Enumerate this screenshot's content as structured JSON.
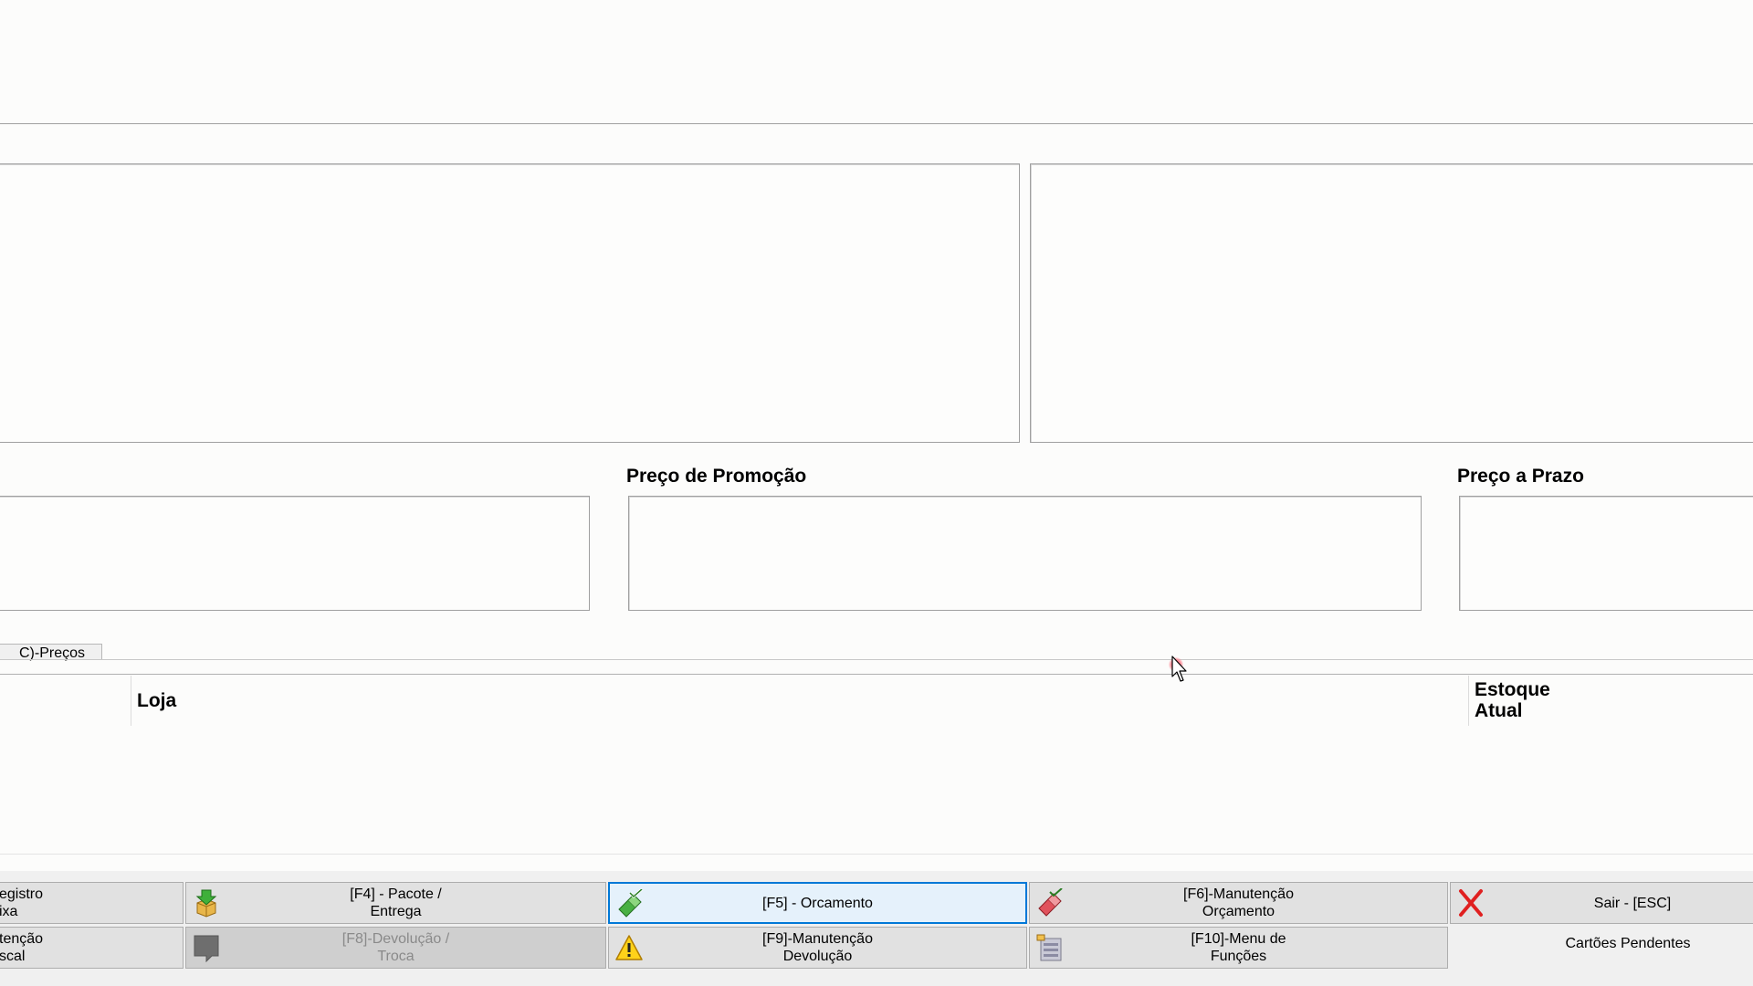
{
  "labels": {
    "preco_promocao": "Preço de Promoção",
    "preco_prazo": "Preço a Prazo"
  },
  "tab": {
    "label": "C)-Preços"
  },
  "grid": {
    "columns": [
      "Loja",
      "Estoque Atual"
    ]
  },
  "toolbar": {
    "row1": [
      {
        "label": "egistro\nixa"
      },
      {
        "label": "[F4] - Pacote /\nEntrega",
        "icon": "package-download-icon"
      },
      {
        "label": "[F5] - Orcamento",
        "icon": "brush-check-icon"
      },
      {
        "label": "[F6]-Manutenção\nOrçamento",
        "icon": "eraser-check-icon"
      },
      {
        "label": "Sair  -  [ESC]",
        "icon": "red-x-icon"
      }
    ],
    "row2": [
      {
        "label": "tenção\nscal"
      },
      {
        "label": "[F8]-Devolução /\nTroca",
        "icon": "gray-box-icon"
      },
      {
        "label": "[F9]-Manutenção\nDevolução",
        "icon": "warning-icon"
      },
      {
        "label": "[F10]-Menu de\nFunções",
        "icon": "menu-list-icon"
      },
      {
        "label": "Cartões Pendentes"
      }
    ]
  }
}
